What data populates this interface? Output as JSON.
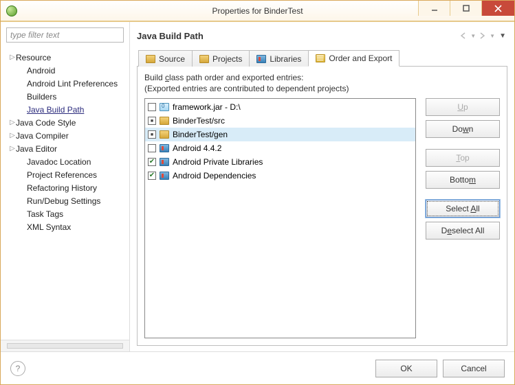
{
  "window": {
    "title": "Properties for BinderTest"
  },
  "filter": {
    "placeholder": "type filter text"
  },
  "tree": {
    "items": [
      {
        "label": "Resource",
        "expandable": true
      },
      {
        "label": "Android"
      },
      {
        "label": "Android Lint Preferences"
      },
      {
        "label": "Builders"
      },
      {
        "label": "Java Build Path",
        "selected": true
      },
      {
        "label": "Java Code Style",
        "expandable": true
      },
      {
        "label": "Java Compiler",
        "expandable": true
      },
      {
        "label": "Java Editor",
        "expandable": true
      },
      {
        "label": "Javadoc Location"
      },
      {
        "label": "Project References"
      },
      {
        "label": "Refactoring History"
      },
      {
        "label": "Run/Debug Settings"
      },
      {
        "label": "Task Tags"
      },
      {
        "label": "XML Syntax"
      }
    ]
  },
  "section": {
    "title": "Java Build Path"
  },
  "tabs": {
    "items": [
      {
        "label": "Source"
      },
      {
        "label": "Projects"
      },
      {
        "label": "Libraries"
      },
      {
        "label": "Order and Export",
        "active": true
      }
    ]
  },
  "desc": {
    "line1_a": "Build ",
    "line1_u": "c",
    "line1_b": "lass path order and exported entries:",
    "line2": "(Exported entries are contributed to dependent projects)"
  },
  "entries": [
    {
      "state": "empty",
      "icon": "jar",
      "label": "framework.jar - D:\\"
    },
    {
      "state": "dot",
      "icon": "pkg",
      "label": "BinderTest/src"
    },
    {
      "state": "dot",
      "icon": "pkg",
      "label": "BinderTest/gen",
      "selected": true
    },
    {
      "state": "empty",
      "icon": "book",
      "label": "Android 4.4.2"
    },
    {
      "state": "chk",
      "icon": "book",
      "label": "Android Private Libraries"
    },
    {
      "state": "chk",
      "icon": "book",
      "label": "Android Dependencies"
    }
  ],
  "buttons": {
    "up_u": "U",
    "up_rest": "p",
    "down_a": "Do",
    "down_u": "w",
    "down_b": "n",
    "top_u": "T",
    "top_rest": "op",
    "bottom_a": "Botto",
    "bottom_u": "m",
    "selectall_a": "Select ",
    "selectall_u": "A",
    "selectall_b": "ll",
    "deselect_a": "D",
    "deselect_u": "e",
    "deselect_b": "select All"
  },
  "footer": {
    "ok": "OK",
    "cancel": "Cancel"
  }
}
